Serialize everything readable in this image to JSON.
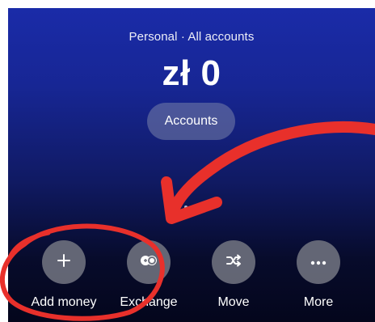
{
  "header": {
    "subtitle": "Personal · All accounts",
    "balance": "zł 0",
    "accounts_button": "Accounts"
  },
  "actions": [
    {
      "label": "Add money",
      "icon": "plus-icon"
    },
    {
      "label": "Exchange",
      "icon": "exchange-icon"
    },
    {
      "label": "Move",
      "icon": "shuffle-icon"
    },
    {
      "label": "More",
      "icon": "more-dots-icon"
    }
  ],
  "colors": {
    "gradient_top": "#1a2ba8",
    "gradient_bottom": "#04061c",
    "annotation_red": "#e8302b",
    "action_circle": "#6e707d"
  }
}
